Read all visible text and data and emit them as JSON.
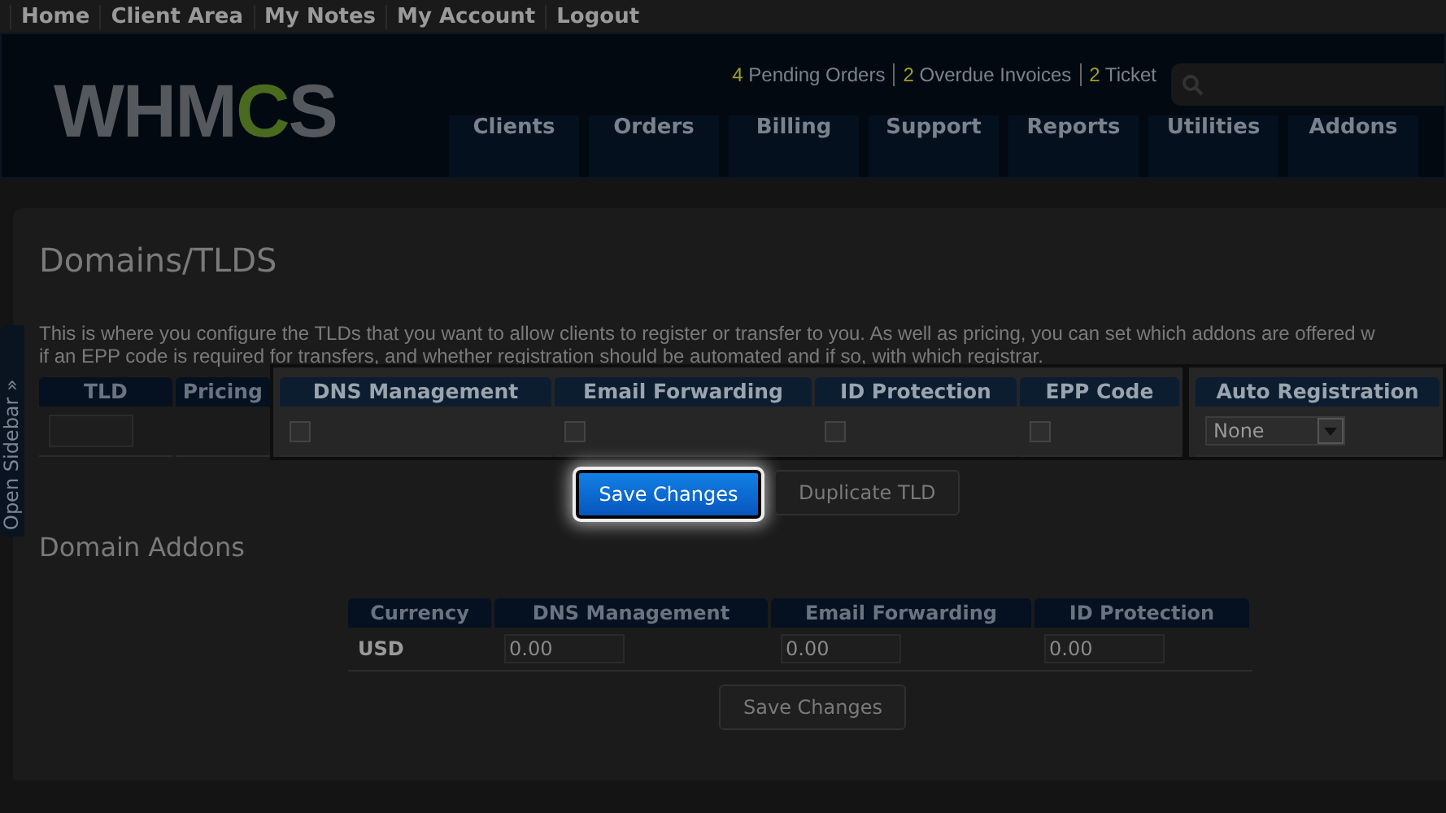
{
  "top_links": [
    "Home",
    "Client Area",
    "My Notes",
    "My Account",
    "Logout"
  ],
  "header": {
    "logo": "WHMCS",
    "stats": [
      {
        "count": "4",
        "label": "Pending Orders"
      },
      {
        "count": "2",
        "label": "Overdue Invoices"
      },
      {
        "count": "2",
        "label": "Ticket"
      }
    ],
    "nav": [
      "Clients",
      "Orders",
      "Billing",
      "Support",
      "Reports",
      "Utilities",
      "Addons"
    ]
  },
  "sidebar_tab": "Open Sidebar »",
  "page": {
    "title": "Domains/TLDS",
    "description": [
      "This is where you configure the TLDs that you want to allow clients to register or transfer to you. As well as pricing, you can set which addons are offered w",
      "if an EPP code is required for transfers, and whether registration should be automated and if so, with which registrar."
    ]
  },
  "tld_table": {
    "columns": [
      "TLD",
      "Pricing",
      "DNS Management",
      "Email Forwarding",
      "ID Protection",
      "EPP Code",
      "Auto Registration"
    ],
    "cells": [
      {
        "kind": "input"
      },
      {
        "kind": "blank"
      },
      {
        "kind": "checkbox",
        "checked": false
      },
      {
        "kind": "checkbox",
        "checked": false
      },
      {
        "kind": "checkbox",
        "checked": false
      },
      {
        "kind": "checkbox",
        "checked": false
      },
      {
        "kind": "select",
        "value": "None"
      }
    ]
  },
  "buttons": [
    {
      "label": "Save Changes",
      "highlighted": true
    },
    {
      "label": "Duplicate TLD",
      "highlighted": false
    }
  ],
  "addons": {
    "title": "Domain Addons",
    "columns": [
      "Currency",
      "DNS Management",
      "Email Forwarding",
      "ID Protection"
    ],
    "rows": [
      {
        "cells": [
          "USD",
          "0.00",
          "0.00",
          "0.00"
        ]
      }
    ],
    "button": "Save Changes"
  }
}
